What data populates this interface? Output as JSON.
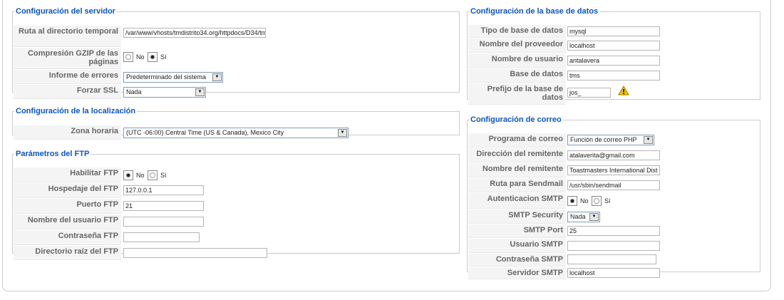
{
  "server": {
    "legend": "Configuración del servidor",
    "path_label": "Ruta al directorio temporal",
    "path_value": "/var/www/vhosts/tmdistrito34.org/httpdocs/D34/tm",
    "gzip_label": "Compresión GZIP de las páginas",
    "gzip_no": "No",
    "gzip_si": "Sí",
    "errors_label": "Informe de errores",
    "errors_value": "Predeterminado del sistema",
    "ssl_label": "Forzar SSL",
    "ssl_value": "Nada"
  },
  "locale": {
    "legend": "Configuración de la localización",
    "tz_label": "Zona horaria",
    "tz_value": "(UTC -06:00) Central Time (US & Canada), Mexico City"
  },
  "ftp": {
    "legend": "Parámetros del FTP",
    "enable_label": "Habilitar FTP",
    "enable_no": "No",
    "enable_si": "Sí",
    "host_label": "Hospedaje del FTP",
    "host_value": "127.0.0.1",
    "port_label": "Puerto FTP",
    "port_value": "21",
    "user_label": "Nombre del usuario FTP",
    "user_value": "",
    "pass_label": "Contraseña FTP",
    "pass_value": "",
    "root_label": "Directorio raíz del FTP",
    "root_value": ""
  },
  "db": {
    "legend": "Configuración de la base de datos",
    "type_label": "Tipo de base de datos",
    "type_value": "mysql",
    "host_label": "Nombre del proveedor",
    "host_value": "localhost",
    "user_label": "Nombre de usuario",
    "user_value": "antalavera",
    "name_label": "Base de datos",
    "name_value": "tms",
    "prefix_label": "Prefijo de la base de datos",
    "prefix_value": "jos_"
  },
  "mail": {
    "legend": "Configuración de correo",
    "program_label": "Programa de correo",
    "program_value": "Función de correo PHP",
    "from_label": "Dirección del remitente",
    "from_value": "atalaverita@gmail.com",
    "fromname_label": "Nombre del remitente",
    "fromname_value": "Toastmasters International Dist",
    "sendmail_label": "Ruta para Sendmail",
    "sendmail_value": "/usr/sbin/sendmail",
    "auth_label": "Autenticacion SMTP",
    "auth_no": "No",
    "auth_si": "Sí",
    "security_label": "SMTP Security",
    "security_value": "Nada",
    "port_label": "SMTP Port",
    "port_value": "25",
    "user_label": "Usuario SMTP",
    "user_value": "",
    "pass_label": "Contraseña SMTP",
    "pass_value": "",
    "host_label": "Servidor SMTP",
    "host_value": "localhost"
  },
  "icons": {
    "warning": "warning-triangle-icon",
    "dropdown": "chevron-down-icon"
  }
}
